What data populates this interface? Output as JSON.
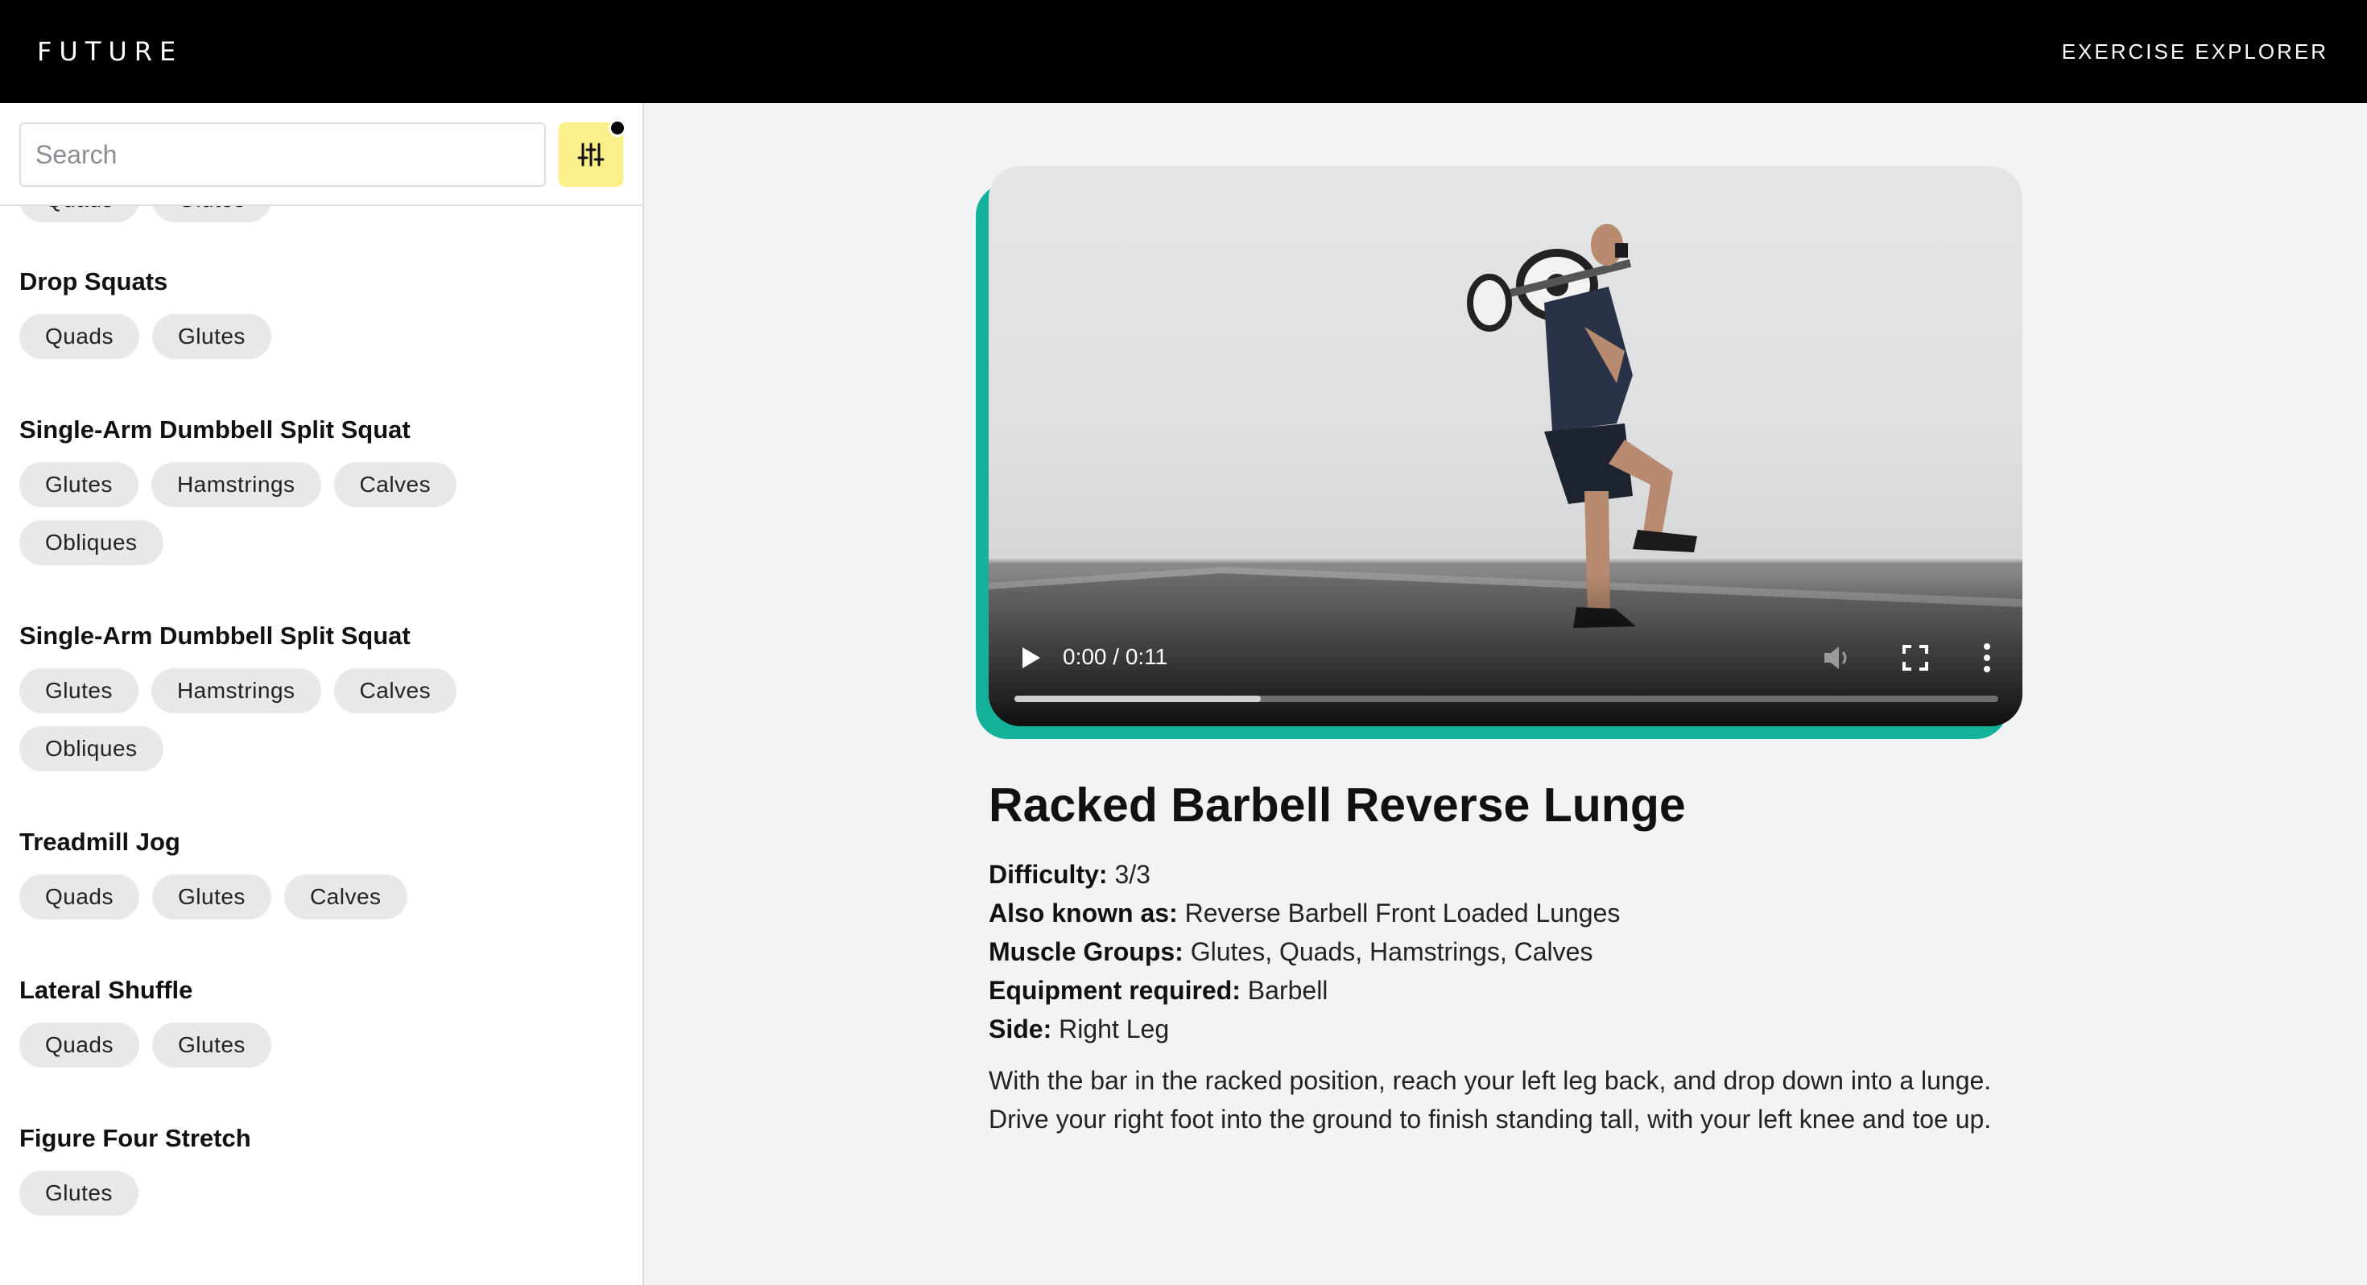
{
  "header": {
    "logo": "FUTURE",
    "nav_link": "EXERCISE EXPLORER"
  },
  "search": {
    "placeholder": "Search",
    "value": ""
  },
  "filter": {
    "icon": "sliders-icon",
    "active_indicator": true
  },
  "exercise_list": [
    {
      "name": "",
      "tags": [
        "Quads",
        "Glutes"
      ]
    },
    {
      "name": "Drop Squats",
      "tags": [
        "Quads",
        "Glutes"
      ]
    },
    {
      "name": "Single-Arm Dumbbell Split Squat",
      "tags": [
        "Glutes",
        "Hamstrings",
        "Calves",
        "Obliques"
      ]
    },
    {
      "name": "Single-Arm Dumbbell Split Squat",
      "tags": [
        "Glutes",
        "Hamstrings",
        "Calves",
        "Obliques"
      ]
    },
    {
      "name": "Treadmill Jog",
      "tags": [
        "Quads",
        "Glutes",
        "Calves"
      ]
    },
    {
      "name": "Lateral Shuffle",
      "tags": [
        "Quads",
        "Glutes"
      ]
    },
    {
      "name": "Figure Four Stretch",
      "tags": [
        "Glutes"
      ]
    }
  ],
  "video": {
    "time": "0:00 / 0:11",
    "progress": 0.25,
    "accent_color": "#14b19b",
    "icons": [
      "play-icon",
      "volume-icon",
      "fullscreen-icon",
      "more-vertical-icon"
    ]
  },
  "detail": {
    "title": "Racked Barbell Reverse Lunge",
    "difficulty_label": "Difficulty:",
    "difficulty_value": "3/3",
    "aka_label": "Also known as:",
    "aka_value": "Reverse Barbell Front Loaded Lunges",
    "muscle_label": "Muscle Groups:",
    "muscle_value": "Glutes, Quads, Hamstrings, Calves",
    "equipment_label": "Equipment required:",
    "equipment_value": "Barbell",
    "side_label": "Side:",
    "side_value": "Right Leg",
    "description": "With the bar in the racked position, reach your left leg back, and drop down into a lunge. Drive your right foot into the ground to finish standing tall, with your left knee and toe up."
  }
}
